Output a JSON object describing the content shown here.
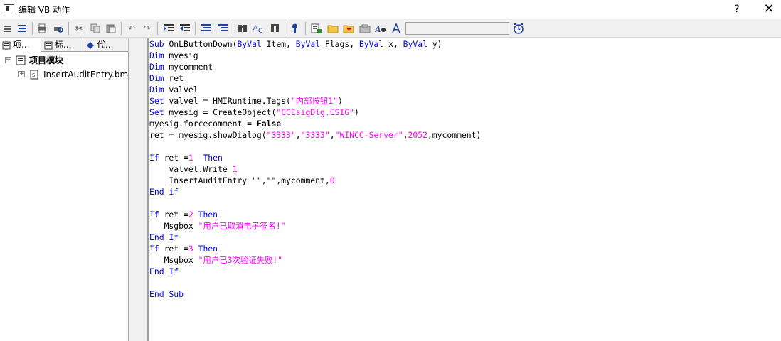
{
  "window": {
    "title": "编辑 VB 动作",
    "help_label": "?",
    "close_label": "✕"
  },
  "toolbar": {
    "icons": [
      "menu-icon",
      "format-icon",
      "print-icon",
      "print-preview-icon",
      "cut-icon",
      "copy-icon",
      "paste-icon",
      "undo-icon",
      "redo-icon",
      "indent-icon",
      "outdent-icon",
      "comment-icon",
      "uncomment-icon",
      "find-icon",
      "replace-icon",
      "goto-icon",
      "syntax-check-icon",
      "add-function-icon",
      "open-folder-icon",
      "new-folder-icon",
      "library-icon",
      "tag-icon",
      "font-icon",
      "trigger-icon"
    ],
    "field_value": ""
  },
  "tree": {
    "tabs": [
      {
        "label": "项..."
      },
      {
        "label": "标..."
      },
      {
        "label": "代..."
      }
    ],
    "root": {
      "label": "项目模块",
      "expander": "−"
    },
    "child": {
      "label": "InsertAuditEntry.bmo",
      "expander": "+"
    }
  },
  "code": [
    [
      {
        "t": "Sub ",
        "c": "kw"
      },
      {
        "t": "OnLButtonDown(",
        "c": "tx"
      },
      {
        "t": "ByVal",
        "c": "kw"
      },
      {
        "t": " Item, ",
        "c": "tx"
      },
      {
        "t": "ByVal",
        "c": "kw"
      },
      {
        "t": " Flags, ",
        "c": "tx"
      },
      {
        "t": "ByVal",
        "c": "kw"
      },
      {
        "t": " x, ",
        "c": "tx"
      },
      {
        "t": "ByVal",
        "c": "kw"
      },
      {
        "t": " y)",
        "c": "tx"
      }
    ],
    [
      {
        "t": "Dim",
        "c": "kw"
      },
      {
        "t": " myesig",
        "c": "tx"
      }
    ],
    [
      {
        "t": "Dim",
        "c": "kw"
      },
      {
        "t": " mycomment",
        "c": "tx"
      }
    ],
    [
      {
        "t": "Dim",
        "c": "kw"
      },
      {
        "t": " ret",
        "c": "tx"
      }
    ],
    [
      {
        "t": "Dim",
        "c": "kw"
      },
      {
        "t": " valvel",
        "c": "tx"
      }
    ],
    [
      {
        "t": "Set",
        "c": "kw"
      },
      {
        "t": " valvel = HMIRuntime.Tags(",
        "c": "tx"
      },
      {
        "t": "\"内部按钮1\"",
        "c": "str"
      },
      {
        "t": ")",
        "c": "tx"
      }
    ],
    [
      {
        "t": "Set",
        "c": "kw"
      },
      {
        "t": " myesig = CreateObject(",
        "c": "tx"
      },
      {
        "t": "\"CCEsigDlg.ESIG\"",
        "c": "str"
      },
      {
        "t": ")",
        "c": "tx"
      }
    ],
    [
      {
        "t": "myesig.forcecomment = ",
        "c": "tx"
      },
      {
        "t": "False",
        "c": "bold"
      }
    ],
    [
      {
        "t": "ret = myesig.showDialog(",
        "c": "tx"
      },
      {
        "t": "\"3333\"",
        "c": "str"
      },
      {
        "t": ",",
        "c": "tx"
      },
      {
        "t": "\"3333\"",
        "c": "str"
      },
      {
        "t": ",",
        "c": "tx"
      },
      {
        "t": "\"WINCC-Server\"",
        "c": "str"
      },
      {
        "t": ",",
        "c": "tx"
      },
      {
        "t": "2052",
        "c": "num"
      },
      {
        "t": ",mycomment)",
        "c": "tx"
      }
    ],
    [],
    [
      {
        "t": "If",
        "c": "kw"
      },
      {
        "t": " ret =",
        "c": "tx"
      },
      {
        "t": "1",
        "c": "num"
      },
      {
        "t": "  ",
        "c": "tx"
      },
      {
        "t": "Then",
        "c": "kw"
      }
    ],
    [
      {
        "t": "    valvel.Write ",
        "c": "tx"
      },
      {
        "t": "1",
        "c": "num"
      }
    ],
    [
      {
        "t": "    InsertAuditEntry \"\",\"\",mycomment,",
        "c": "tx"
      },
      {
        "t": "0",
        "c": "num"
      }
    ],
    [
      {
        "t": "End",
        "c": "kw"
      },
      {
        "t": " ",
        "c": "tx"
      },
      {
        "t": "if",
        "c": "kw"
      }
    ],
    [],
    [
      {
        "t": "If",
        "c": "kw"
      },
      {
        "t": " ret =",
        "c": "tx"
      },
      {
        "t": "2",
        "c": "num"
      },
      {
        "t": " ",
        "c": "tx"
      },
      {
        "t": "Then",
        "c": "kw"
      }
    ],
    [
      {
        "t": "   Msgbox ",
        "c": "tx"
      },
      {
        "t": "\"用户已取消电子签名!\"",
        "c": "str"
      }
    ],
    [
      {
        "t": "End",
        "c": "kw"
      },
      {
        "t": " ",
        "c": "tx"
      },
      {
        "t": "If",
        "c": "kw"
      }
    ],
    [
      {
        "t": "If",
        "c": "kw"
      },
      {
        "t": " ret =",
        "c": "tx"
      },
      {
        "t": "3",
        "c": "num"
      },
      {
        "t": " ",
        "c": "tx"
      },
      {
        "t": "Then",
        "c": "kw"
      }
    ],
    [
      {
        "t": "   Msgbox ",
        "c": "tx"
      },
      {
        "t": "\"用户已3次验证失败!\"",
        "c": "str"
      }
    ],
    [
      {
        "t": "End",
        "c": "kw"
      },
      {
        "t": " ",
        "c": "tx"
      },
      {
        "t": "If",
        "c": "kw"
      }
    ],
    [],
    [
      {
        "t": "End",
        "c": "kw"
      },
      {
        "t": " ",
        "c": "tx"
      },
      {
        "t": "Sub",
        "c": "kw"
      }
    ]
  ]
}
